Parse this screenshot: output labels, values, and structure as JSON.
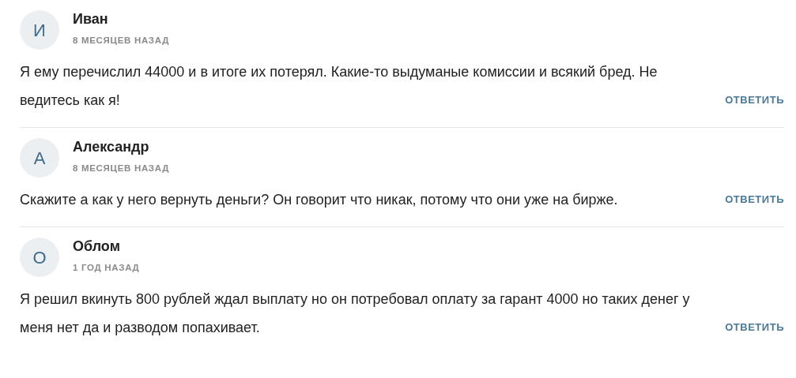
{
  "comments": [
    {
      "avatar_letter": "И",
      "author": "Иван",
      "time": "8 МЕСЯЦЕВ НАЗАД",
      "text": "Я ему перечислил 44000 и в итоге их потерял. Какие-то выдуманые комиссии и всякий бред. Не ведитесь как я!",
      "reply": "ОТВЕТИТЬ"
    },
    {
      "avatar_letter": "А",
      "author": "Александр",
      "time": "8 МЕСЯЦЕВ НАЗАД",
      "text": "Скажите а как у него вернуть деньги? Он говорит что никак, потому что они уже на бирже.",
      "reply": "ОТВЕТИТЬ"
    },
    {
      "avatar_letter": "О",
      "author": "Облом",
      "time": "1 ГОД НАЗАД",
      "text": "Я решил вкинуть 800 рублей ждал выплату но он потребовал оплату за гарант 4000 но таких денег у меня нет да и разводом попахивает.",
      "reply": "ОТВЕТИТЬ"
    }
  ]
}
